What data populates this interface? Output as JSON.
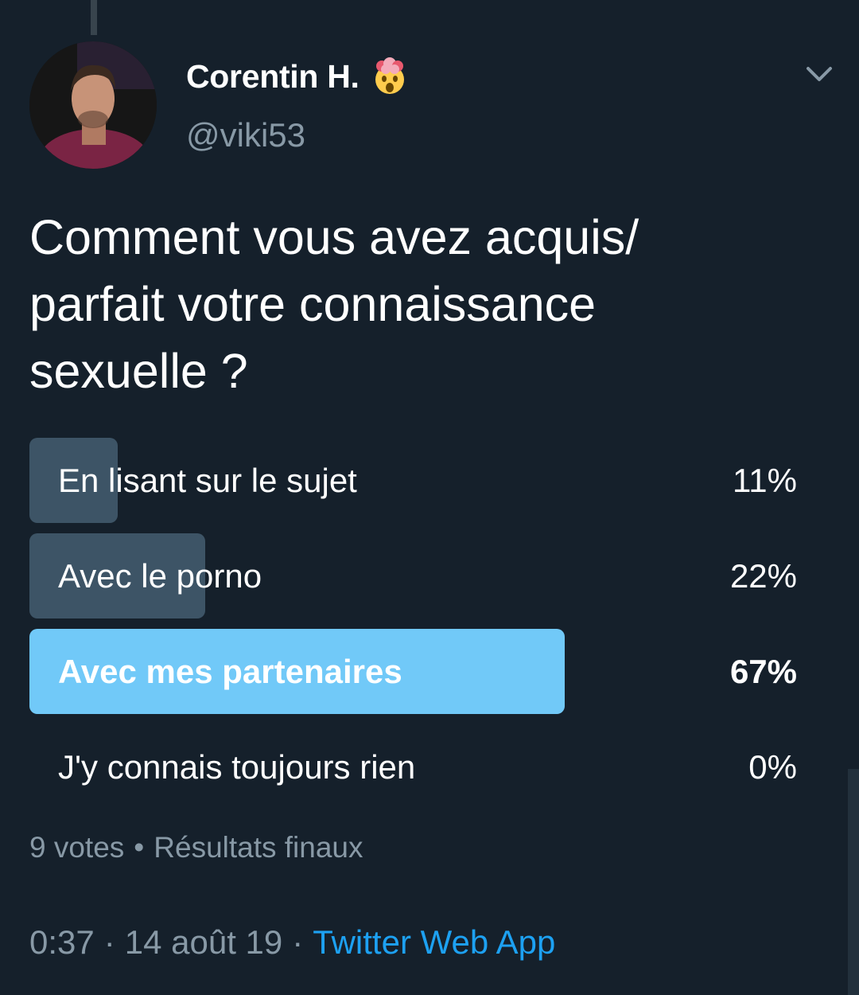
{
  "tweet": {
    "author": {
      "display_name": "Corentin H.",
      "emoji": "exploding-head-emoji",
      "handle": "@viki53"
    },
    "text": "Comment vous avez acquis/\nparfait votre connaissance\nsexuelle ?",
    "poll": {
      "options": [
        {
          "label": "En lisant sur le sujet",
          "percent_text": "11%",
          "percent": 11,
          "winner": false
        },
        {
          "label": "Avec le porno",
          "percent_text": "22%",
          "percent": 22,
          "winner": false
        },
        {
          "label": "Avec mes partenaires",
          "percent_text": "67%",
          "percent": 67,
          "winner": true
        },
        {
          "label": "J'y connais toujours rien",
          "percent_text": "0%",
          "percent": 0,
          "winner": false
        }
      ],
      "votes": "9 votes",
      "separator": "•",
      "status": "Résultats finaux"
    },
    "time": "0:37",
    "date": "14 août 19",
    "dot": "·",
    "source": "Twitter Web App"
  },
  "colors": {
    "background": "#15202b",
    "bar": "#3d5466",
    "winner_bar": "#71c9f8",
    "link": "#1da1f2",
    "secondary_text": "#8899a6"
  },
  "icons": {
    "menu": "chevron-down-icon",
    "avatar": "avatar-photo"
  }
}
